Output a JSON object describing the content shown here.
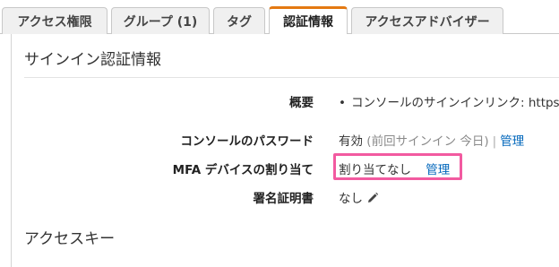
{
  "tabs": [
    {
      "label": "アクセス権限"
    },
    {
      "label": "グループ (1)"
    },
    {
      "label": "タグ"
    },
    {
      "label": "認証情報",
      "active": true
    },
    {
      "label": "アクセスアドバイザー"
    }
  ],
  "signin": {
    "title": "サインイン認証情報",
    "overview_label": "概要",
    "overview_value": "コンソールのサインインリンク: https",
    "console_password_label": "コンソールのパスワード",
    "console_password_status": "有効",
    "console_password_last": "(前回サインイン 今日)",
    "console_password_sep": "|",
    "console_password_manage": "管理",
    "mfa_label": "MFA デバイスの割り当て",
    "mfa_value": "割り当てなし",
    "mfa_manage": "管理",
    "signing_cert_label": "署名証明書",
    "signing_cert_value": "なし"
  },
  "access_keys": {
    "title": "アクセスキー"
  },
  "colors": {
    "accent_tab": "#e47911",
    "link": "#0066bb",
    "highlight": "#f25aa0"
  },
  "icons": {
    "edit": "pencil-icon"
  }
}
